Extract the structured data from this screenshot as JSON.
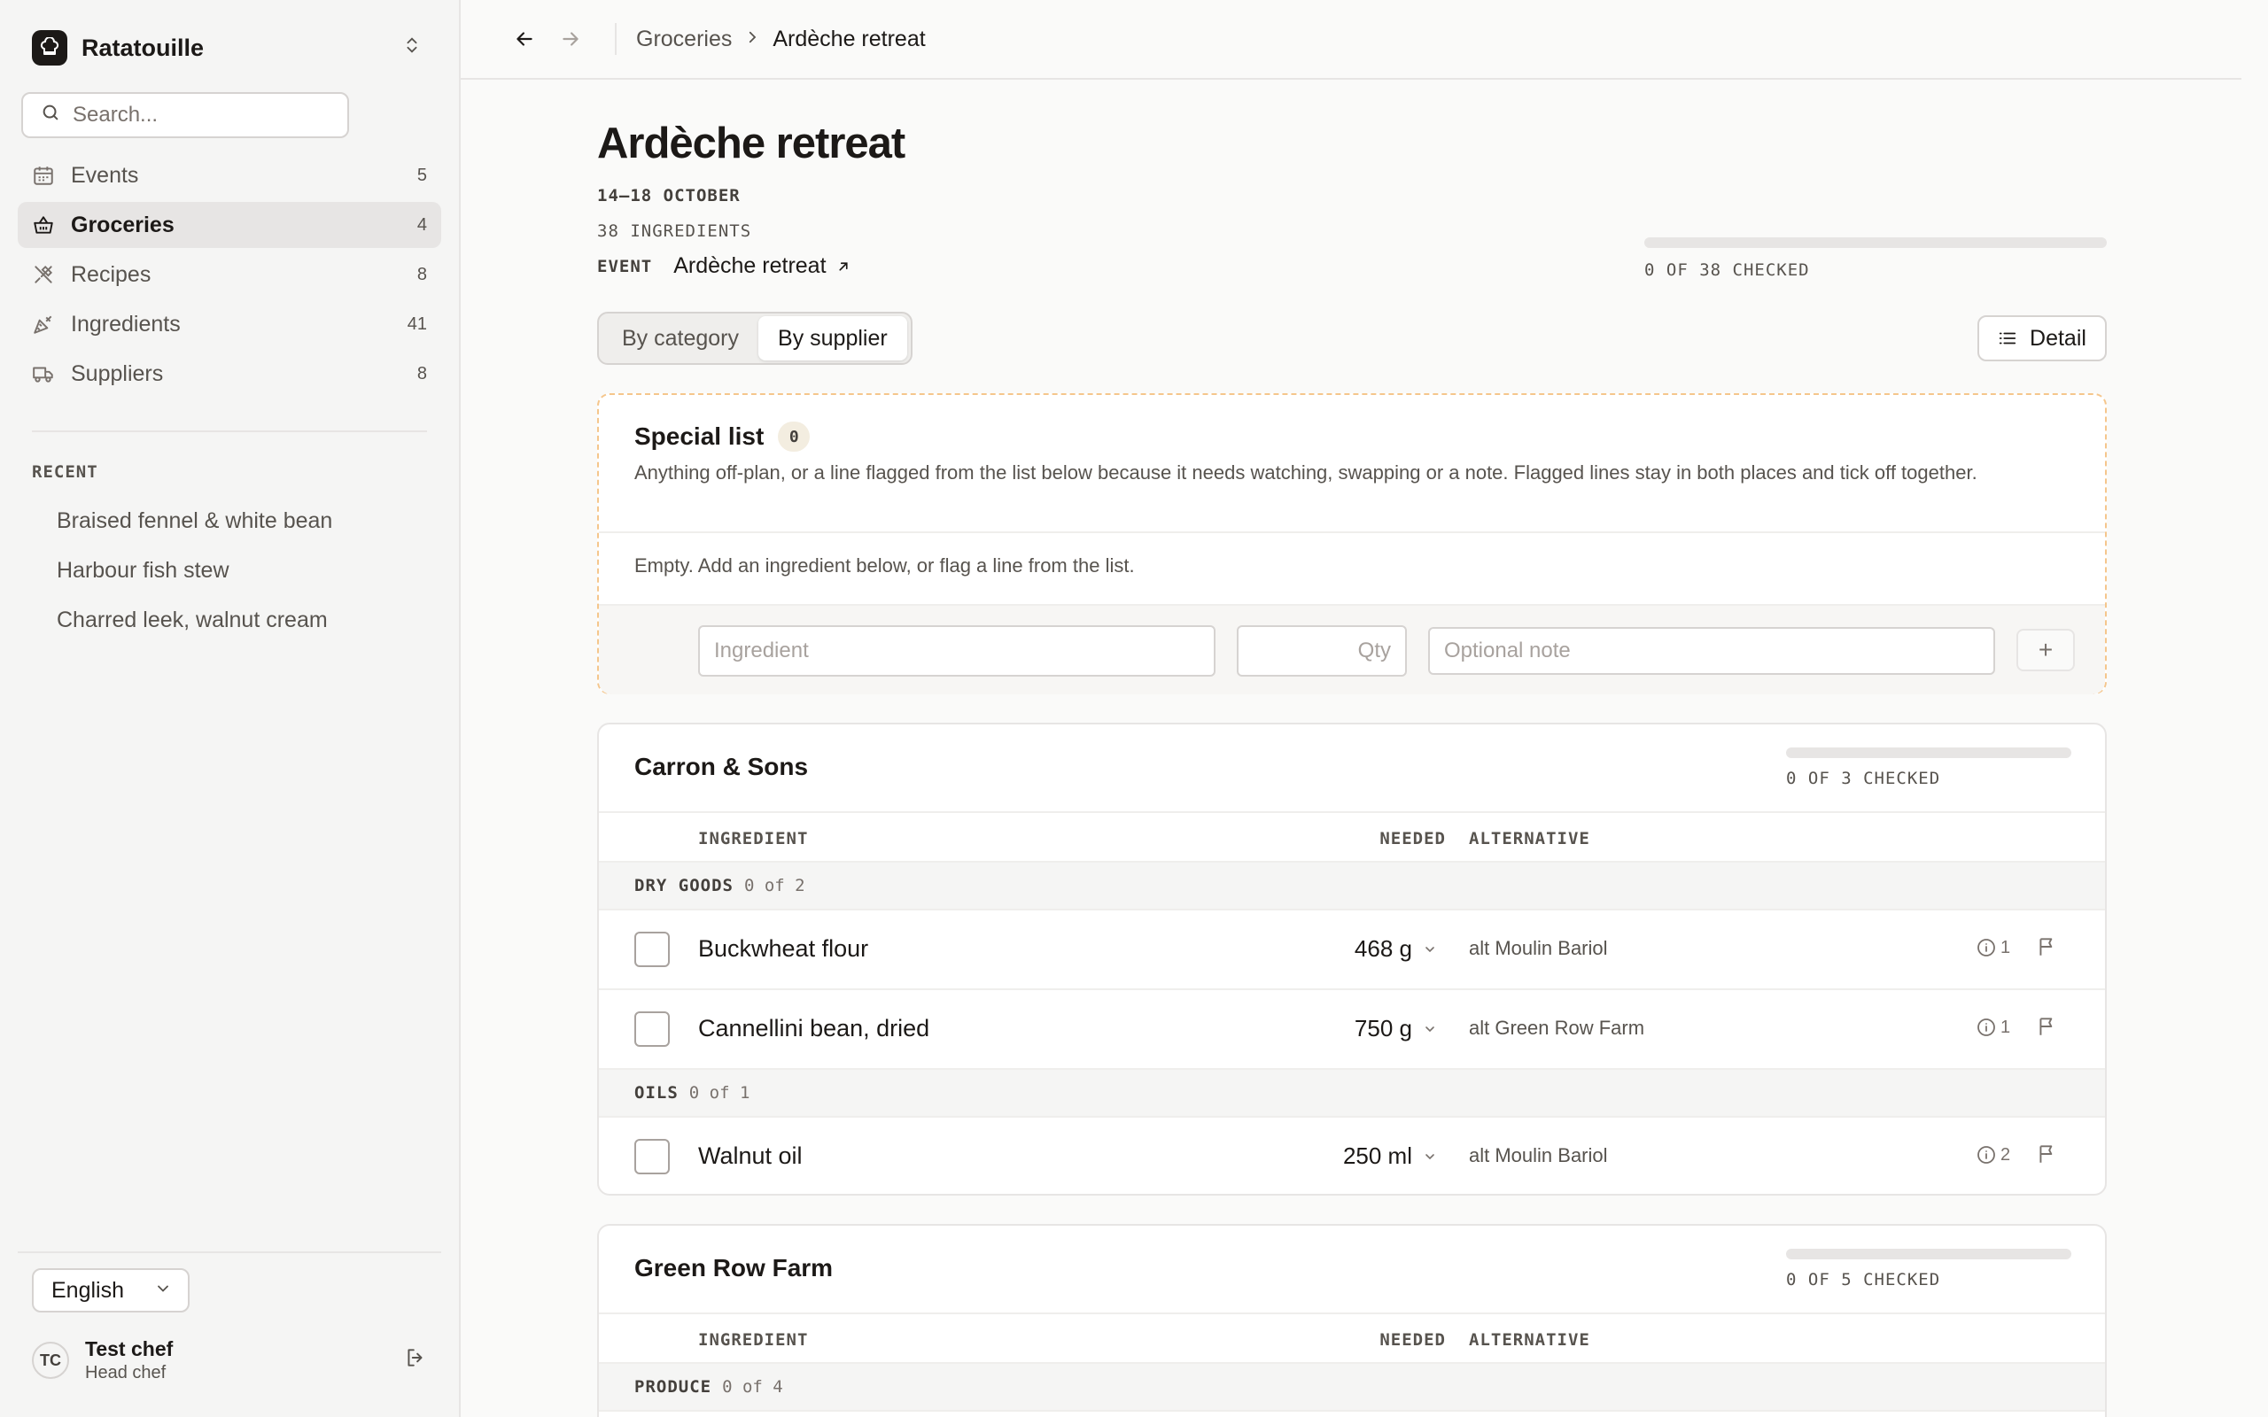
{
  "app": {
    "name": "Ratatouille",
    "search_placeholder": "Search..."
  },
  "nav": [
    {
      "label": "Events",
      "count": "5",
      "icon": "calendar-icon",
      "active": false
    },
    {
      "label": "Groceries",
      "count": "4",
      "icon": "basket-icon",
      "active": true
    },
    {
      "label": "Recipes",
      "count": "8",
      "icon": "utensils-icon",
      "active": false
    },
    {
      "label": "Ingredients",
      "count": "41",
      "icon": "carrot-icon",
      "active": false
    },
    {
      "label": "Suppliers",
      "count": "8",
      "icon": "truck-icon",
      "active": false
    }
  ],
  "recent": {
    "title": "RECENT",
    "items": [
      "Braised fennel & white bean",
      "Harbour fish stew",
      "Charred leek, walnut cream"
    ]
  },
  "footer": {
    "language": "English",
    "user_initials": "TC",
    "user_name": "Test chef",
    "user_role": "Head chef"
  },
  "breadcrumb": {
    "parent": "Groceries",
    "current": "Ardèche retreat"
  },
  "page": {
    "title": "Ardèche retreat",
    "dates": "14–18 OCTOBER",
    "ingredient_count": "38 INGREDIENTS",
    "event_label": "EVENT",
    "event_link": "Ardèche retreat",
    "progress_fraction": 0,
    "progress_label": "0 OF 38 CHECKED"
  },
  "view_toggle": {
    "by_category": "By category",
    "by_supplier": "By supplier",
    "active": "by_supplier"
  },
  "detail_button": "Detail",
  "special_list": {
    "title": "Special list",
    "count": "0",
    "description": "Anything off-plan, or a line flagged from the list below because it needs watching, swapping or a note. Flagged lines stay in both places and tick off together.",
    "empty_text": "Empty. Add an ingredient below, or flag a line from the list.",
    "ingredient_placeholder": "Ingredient",
    "qty_placeholder": "Qty",
    "note_placeholder": "Optional note",
    "add_label": "+"
  },
  "columns": {
    "ingredient": "INGREDIENT",
    "needed": "NEEDED",
    "alternative": "ALTERNATIVE"
  },
  "suppliers": [
    {
      "name": "Carron & Sons",
      "progress_fraction": 0,
      "progress_label": "0 OF 3 CHECKED",
      "groups": [
        {
          "name": "DRY GOODS",
          "count": "0 of 2",
          "rows": [
            {
              "name": "Buckwheat flour",
              "qty": "468 g",
              "alt": "alt Moulin Bariol",
              "info": "1"
            },
            {
              "name": "Cannellini bean, dried",
              "qty": "750 g",
              "alt": "alt Green Row Farm",
              "info": "1"
            }
          ]
        },
        {
          "name": "OILS",
          "count": "0 of 1",
          "rows": [
            {
              "name": "Walnut oil",
              "qty": "250 ml",
              "alt": "alt Moulin Bariol",
              "info": "2"
            }
          ]
        }
      ]
    },
    {
      "name": "Green Row Farm",
      "progress_fraction": 0,
      "progress_label": "0 OF 5 CHECKED",
      "groups": [
        {
          "name": "PRODUCE",
          "count": "0 of 4",
          "rows": []
        }
      ]
    }
  ]
}
